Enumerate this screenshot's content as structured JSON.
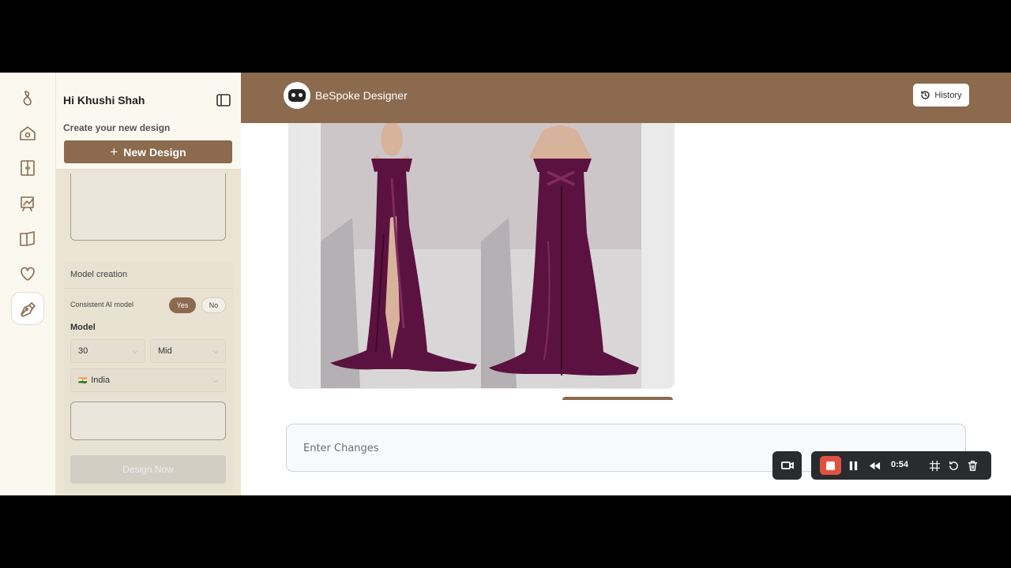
{
  "sidebar": {
    "greeting": "Hi Khushi Shah",
    "create_label": "Create your new design",
    "new_design_label": "New Design",
    "model_section": {
      "title": "Model creation",
      "consistent_label": "Consistent AI model",
      "yes_label": "Yes",
      "no_label": "No",
      "selected": "Yes",
      "model_label": "Model",
      "age_value": "30",
      "range_value": "Mid",
      "country_flag": "🇮🇳",
      "country_value": "India"
    },
    "design_now_label": "Design Now"
  },
  "rail": {
    "icons": [
      "brand-logo-icon",
      "home-icon",
      "wardrobe-icon",
      "sketch-board-icon",
      "catalog-book-icon",
      "heart-icon",
      "pen-nib-icon"
    ],
    "active": "pen-nib-icon"
  },
  "header": {
    "app_title": "BeSpoke Designer",
    "history_label": "History"
  },
  "main": {
    "changes_placeholder": "Enter Changes"
  },
  "recorder": {
    "time": "0:54"
  },
  "colors": {
    "accent": "#8b6a4e",
    "sidebar_bg": "#ece4d2",
    "rail_bg": "#fbf8f0",
    "gown": "#5b1240",
    "record_red": "#e0513f"
  }
}
